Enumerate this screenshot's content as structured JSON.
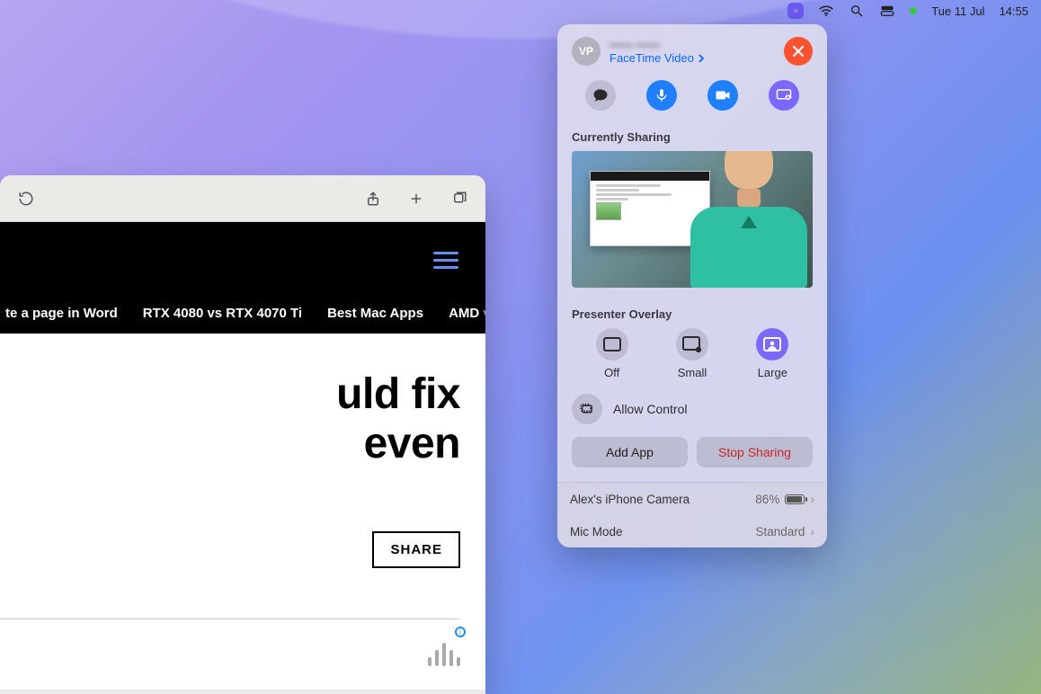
{
  "menubar": {
    "date": "Tue 11 Jul",
    "time": "14:55"
  },
  "safari": {
    "tags": {
      "t1_partial": "te a page in Word",
      "t2": "RTX 4080 vs RTX 4070 Ti",
      "t3": "Best Mac Apps",
      "t4a": "AMD",
      "t4b": " vs In"
    },
    "headline_l1": "uld fix",
    "headline_l2": "even",
    "share_label": "SHARE"
  },
  "panel": {
    "avatar_initials": "VP",
    "contact_name": "—— ——",
    "subtitle": "FaceTime Video",
    "currently_sharing_label": "Currently Sharing",
    "presenter_overlay_label": "Presenter Overlay",
    "overlay_opts": {
      "off": "Off",
      "small": "Small",
      "large": "Large"
    },
    "allow_control_label": "Allow Control",
    "add_app_label": "Add App",
    "stop_sharing_label": "Stop Sharing",
    "camera_row_label": "Alex's iPhone Camera",
    "camera_battery": "86%",
    "mic_mode_label": "Mic Mode",
    "mic_mode_value": "Standard"
  }
}
